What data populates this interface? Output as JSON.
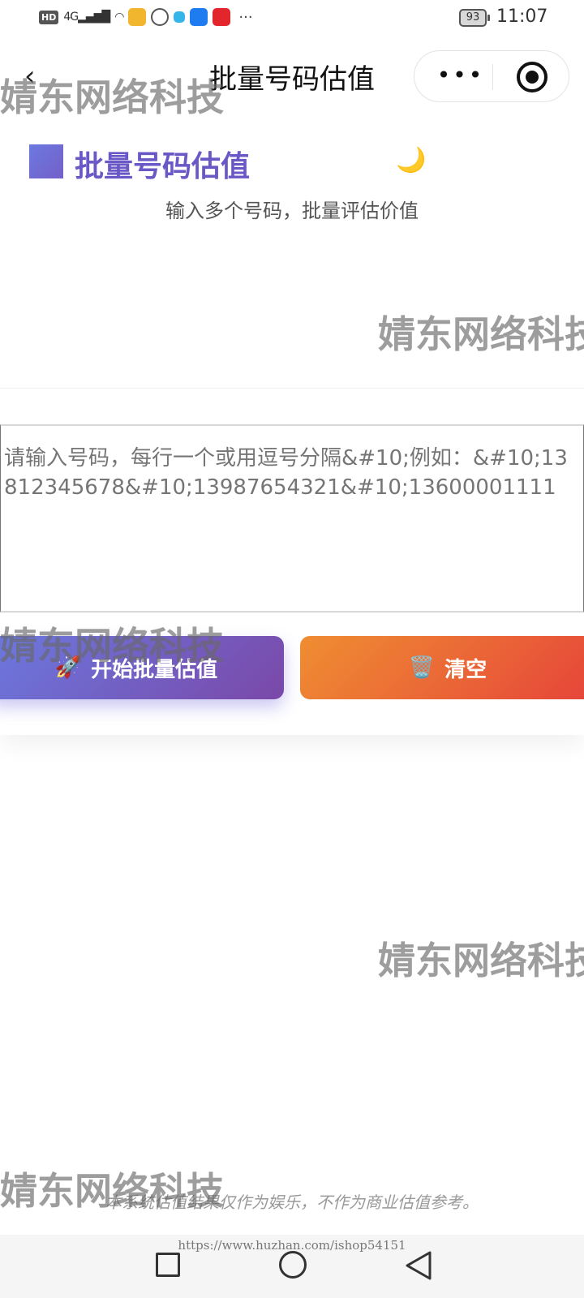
{
  "status_bar": {
    "network_label": "HD",
    "signal_label": "4G",
    "battery": "93",
    "time": "11:07",
    "overflow": "···",
    "icons": [
      "hd-icon",
      "signal-icon",
      "wifi-icon",
      "weibo-icon",
      "wechat-icon",
      "app-icon",
      "cloud-app-icon",
      "red-app-icon"
    ]
  },
  "nav": {
    "back_symbol": "‹",
    "title": "批量号码估值",
    "more_symbol": "•••"
  },
  "header": {
    "title": "批量号码估值",
    "theme_icon": "🌙",
    "subtitle": "输入多个号码，批量评估价值"
  },
  "input": {
    "placeholder": "请输入号码，每行一个或用逗号分隔&#10;例如：&#10;13812345678&#10;13987654321&#10;13600001111"
  },
  "buttons": {
    "start_emoji": "🚀",
    "start_label": "开始批量估值",
    "clear_emoji": "🗑️",
    "clear_label": "清空"
  },
  "footnote": "本系统估值结果仅作为娱乐，不作为商业估值参考。",
  "watermark": "婧东网络科技",
  "source_url": "https://www.huzhan.com/ishop54151",
  "colors": {
    "accent_purple": "#6a58c6",
    "start_gradient": [
      "#6b79e0",
      "#7a48a8"
    ],
    "clear_gradient": [
      "#ef8e32",
      "#e6443a"
    ]
  }
}
